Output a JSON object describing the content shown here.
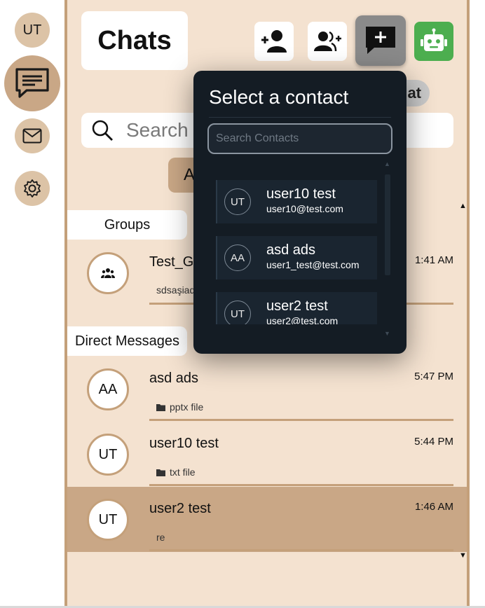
{
  "rail": {
    "avatar_initials": "UT",
    "items": [
      {
        "icon": "chat-icon",
        "active": true
      },
      {
        "icon": "mail-icon",
        "active": false
      },
      {
        "icon": "gear-icon",
        "active": false
      }
    ]
  },
  "header": {
    "title": "Chats",
    "buttons": {
      "add_contact": "add-contact-icon",
      "add_group": "add-group-icon",
      "new_chat": "new-chat-icon",
      "bot": "bot-icon"
    },
    "behind_popup_text": "at"
  },
  "search": {
    "placeholder": "Search"
  },
  "filter": {
    "label": "A"
  },
  "sections": {
    "groups_label": "Groups",
    "direct_label": "Direct Messages"
  },
  "groups": [
    {
      "name": "Test_G",
      "preview": "sdsaşiad",
      "time": "1:41 AM"
    }
  ],
  "direct": [
    {
      "initials": "AA",
      "name": "asd ads",
      "preview": "pptx file",
      "time": "5:47 PM",
      "selected": false
    },
    {
      "initials": "UT",
      "name": "user10 test",
      "preview": "txt file",
      "time": "5:44 PM",
      "selected": false
    },
    {
      "initials": "UT",
      "name": "user2 test",
      "preview": "re",
      "time": "1:46 AM",
      "selected": true
    }
  ],
  "popup": {
    "title": "Select a contact",
    "search_placeholder": "Search Contacts",
    "contacts": [
      {
        "initials": "UT",
        "name": "user10 test",
        "email": "user10@test.com"
      },
      {
        "initials": "AA",
        "name": "asd ads",
        "email": "user1_test@test.com"
      },
      {
        "initials": "UT",
        "name": "user2 test",
        "email": "user2@test.com"
      }
    ]
  },
  "colors": {
    "panel_bg": "#f4e2d0",
    "accent": "#c4a07a",
    "popup_bg": "#141c24",
    "bot_green": "#4cae4f"
  }
}
